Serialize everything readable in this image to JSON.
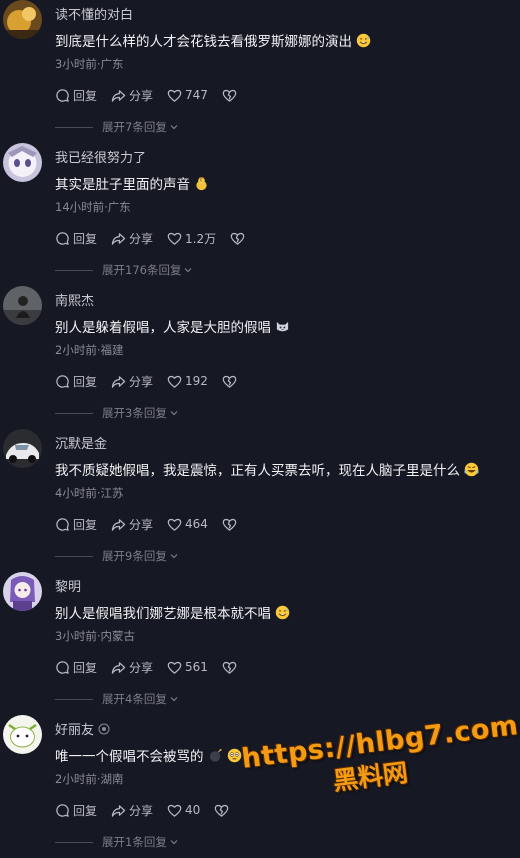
{
  "comments": [
    {
      "username": "读不懂的对白",
      "text": "到底是什么样的人才会花钱去看俄罗斯娜娜的演出",
      "emoji": "sweat-smile",
      "time": "3小时前",
      "location": "广东",
      "reply_label": "回复",
      "share_label": "分享",
      "likes": "747",
      "expand_label": "展开7条回复"
    },
    {
      "username": "我已经很努力了",
      "text": "其实是肚子里面的声音",
      "emoji": "chick",
      "time": "14小时前",
      "location": "广东",
      "reply_label": "回复",
      "share_label": "分享",
      "likes": "1.2万",
      "expand_label": "展开176条回复"
    },
    {
      "username": "南熙杰",
      "text": "别人是躲着假唱，人家是大胆的假唱",
      "emoji": "cat",
      "time": "2小时前",
      "location": "福建",
      "reply_label": "回复",
      "share_label": "分享",
      "likes": "192",
      "expand_label": "展开3条回复"
    },
    {
      "username": "沉默是金",
      "text": "我不质疑她假唱，我是震惊，正有人买票去听，现在人脑子里是什么",
      "emoji": "rofl",
      "time": "4小时前",
      "location": "江苏",
      "reply_label": "回复",
      "share_label": "分享",
      "likes": "464",
      "expand_label": "展开9条回复"
    },
    {
      "username": "黎明",
      "text": "别人是假唱我们娜艺娜是根本就不唱",
      "emoji": "sweat-smile",
      "time": "3小时前",
      "location": "内蒙古",
      "reply_label": "回复",
      "share_label": "分享",
      "likes": "561",
      "expand_label": "展开4条回复"
    },
    {
      "username": "好丽友",
      "text": "唯一一个假唱不会被骂的",
      "emoji": "flushed",
      "time": "2小时前",
      "location": "湖南",
      "reply_label": "回复",
      "share_label": "分享",
      "likes": "40",
      "expand_label": "展开1条回复"
    }
  ],
  "watermark": {
    "url": "https://hlbg7.com",
    "sub": "黑料网"
  },
  "colors": {
    "background": "#161823",
    "watermark": "#f39b12"
  }
}
